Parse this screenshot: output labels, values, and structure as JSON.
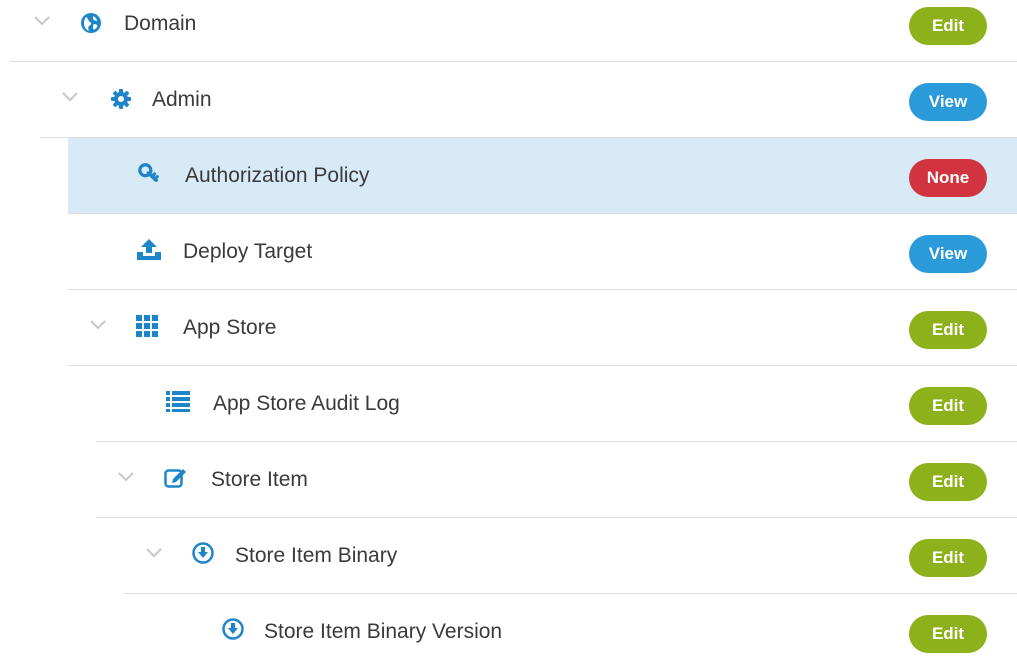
{
  "colors": {
    "edit": "#8db11a",
    "view": "#2b9ad8",
    "none": "#d2343f",
    "icon_blue": "#1e86c8",
    "selected_bg": "#d9eaf7"
  },
  "tree": [
    {
      "label": "Domain",
      "permission": "Edit",
      "icon": "globe-icon",
      "expanded": true
    },
    {
      "label": "Admin",
      "permission": "View",
      "icon": "gear-icon",
      "expanded": true
    },
    {
      "label": "Authorization Policy",
      "permission": "None",
      "icon": "key-icon",
      "selected": true
    },
    {
      "label": "Deploy Target",
      "permission": "View",
      "icon": "upload-icon"
    },
    {
      "label": "App Store",
      "permission": "Edit",
      "icon": "grid-icon",
      "expanded": true
    },
    {
      "label": "App Store Audit Log",
      "permission": "Edit",
      "icon": "list-icon"
    },
    {
      "label": "Store Item",
      "permission": "Edit",
      "icon": "edit-icon",
      "expanded": true
    },
    {
      "label": "Store Item Binary",
      "permission": "Edit",
      "icon": "download-circle-icon",
      "expanded": true
    },
    {
      "label": "Store Item Binary Version",
      "permission": "Edit",
      "icon": "download-circle-icon"
    }
  ]
}
